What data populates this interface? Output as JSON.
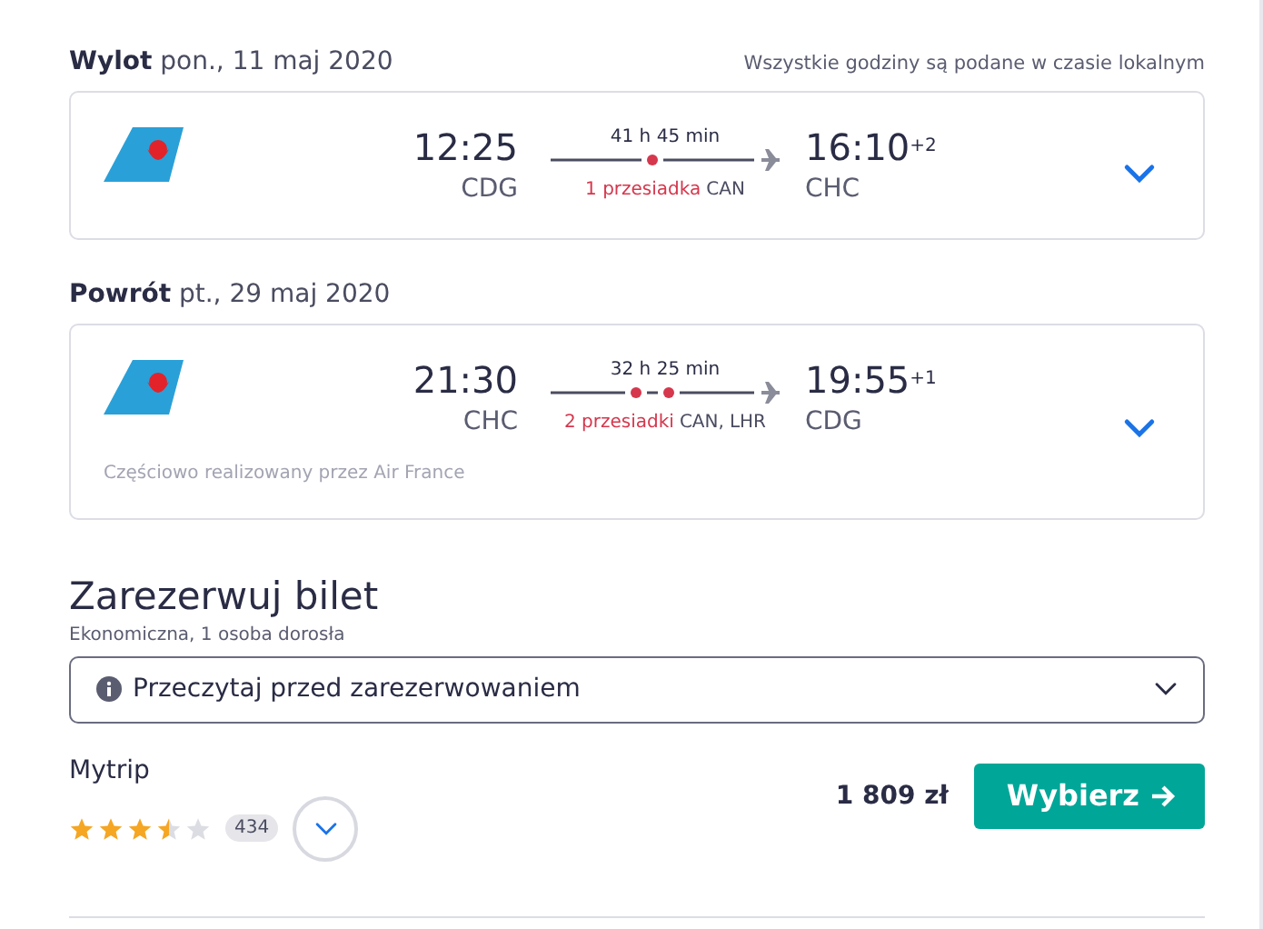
{
  "note": "Wszystkie godziny są podane w czasie lokalnym",
  "flights": [
    {
      "label": "Wylot",
      "date": "pon., 11 maj 2020",
      "depart_time": "12:25",
      "depart_airport": "CDG",
      "duration": "41 h 45 min",
      "stops_label": "1 przesiadka",
      "layovers": [
        {
          "airport": "CAN"
        }
      ],
      "arrive_time": "16:10",
      "day_offset": "+2",
      "arrive_airport": "CHC"
    },
    {
      "label": "Powrót",
      "date": "pt., 29 maj 2020",
      "depart_time": "21:30",
      "depart_airport": "CHC",
      "duration": "32 h 25 min",
      "stops_label": "2 przesiadki",
      "layovers": [
        {
          "airport": "CAN,"
        },
        {
          "airport": "LHR"
        }
      ],
      "arrive_time": "19:55",
      "day_offset": "+1",
      "arrive_airport": "CDG",
      "operated_by": "Częściowo realizowany przez Air France"
    }
  ],
  "booking": {
    "title": "Zarezerwuj bilet",
    "subtitle": "Ekonomiczna, 1 osoba dorosła",
    "info": "Przeczytaj przed zarezerwowaniem",
    "provider": "Mytrip",
    "stars": 3.5,
    "reviews": "434",
    "price": "1 809 zł",
    "button": "Wybierz"
  }
}
